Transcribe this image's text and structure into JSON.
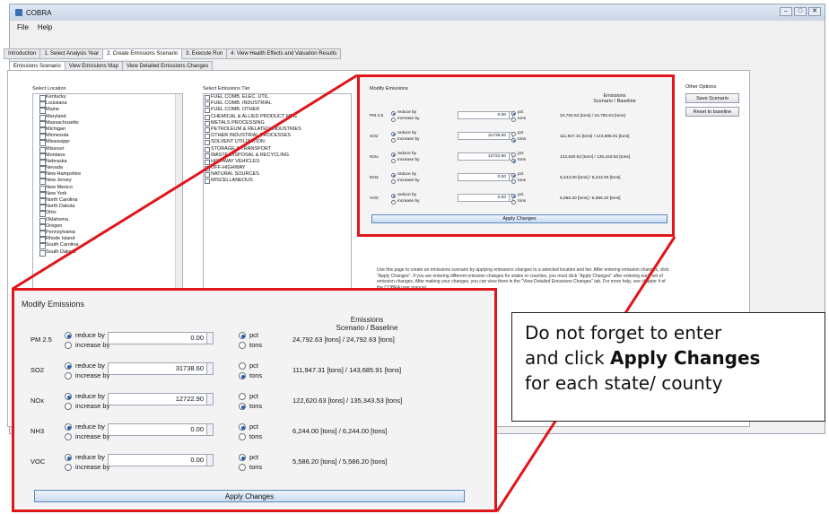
{
  "window": {
    "title": "COBRA"
  },
  "menu": [
    "File",
    "Help"
  ],
  "main_tabs": [
    {
      "label": "Introduction",
      "active": false
    },
    {
      "label": "1. Select Analysis Year",
      "active": false
    },
    {
      "label": "2. Create Emissions Scenario",
      "active": true
    },
    {
      "label": "3. Execute Run",
      "active": false
    },
    {
      "label": "4. View Health Effects and Valuation Results",
      "active": false
    }
  ],
  "sub_tabs": [
    {
      "label": "Emissions Scenario",
      "active": true
    },
    {
      "label": "View Emissions Map",
      "active": false
    },
    {
      "label": "View Detailed Emissions Changes",
      "active": false
    }
  ],
  "select_location": {
    "label": "Select Location",
    "items": [
      "Kentucky",
      "Louisiana",
      "Maine",
      "Maryland",
      "Massachusetts",
      "Michigan",
      "Minnesota",
      "Mississippi",
      "Missouri",
      "Montana",
      "Nebraska",
      "Nevada",
      "New Hampshire",
      "New Jersey",
      "New Mexico",
      "New York",
      "North Carolina",
      "North Dakota",
      "Ohio",
      "Oklahoma",
      "Oregon",
      "Pennsylvania",
      "Rhode Island",
      "South Carolina",
      "South Dakota"
    ]
  },
  "select_tier": {
    "label": "Select Emissions Tier",
    "items": [
      "FUEL COMB. ELEC. UTIL.",
      "FUEL COMB. INDUSTRIAL",
      "FUEL COMB. OTHER",
      "CHEMICAL & ALLIED PRODUCT MFG",
      "METALS PROCESSING",
      "PETROLEUM & RELATED INDUSTRIES",
      "OTHER INDUSTRIAL PROCESSES",
      "SOLVENT UTILIZATION",
      "STORAGE & TRANSPORT",
      "WASTE DISPOSAL & RECYCLING",
      "HIGHWAY VEHICLES",
      "OFF-HIGHWAY",
      "NATURAL SOURCES",
      "MISCELLANEOUS"
    ]
  },
  "other_options": {
    "label": "Other Options",
    "save": "Save Scenario",
    "reset": "Reset to baseline"
  },
  "help_text": "Use this page to create an emissions scenario by applying emissions changes to a selected location and tier. After entering emission changes, click \"Apply Changes\". If you are entering different emission changes for states or counties, you must click \"Apply Changes\" after entering each set of emission changes. After making your changes, you can view them in the \"View Detailed Emissions Changes\" tab. For more help, see chapter 4 of the COBRA user manual.",
  "modify": {
    "title": "Modify Emissions",
    "header_line1": "Emissions",
    "header_line2": "Scenario / Baseline",
    "reduce_label": "reduce by",
    "increase_label": "increase by",
    "pct_label": "pct",
    "tons_label": "tons",
    "apply_label": "Apply Changes",
    "rows": [
      {
        "pollutant": "PM 2.5",
        "value": "0.00",
        "reduce": true,
        "unit_pct": true,
        "result": "24,792.63 [tons] / 24,792.63 [tons]"
      },
      {
        "pollutant": "SO2",
        "value": "31738.60",
        "reduce": true,
        "unit_pct": false,
        "result": "111,947.31 [tons] / 143,685.91 [tons]"
      },
      {
        "pollutant": "NOx",
        "value": "12722.90",
        "reduce": true,
        "unit_pct": false,
        "result": "122,620.63 [tons] / 135,343.53 [tons]"
      },
      {
        "pollutant": "NH3",
        "value": "0.00",
        "reduce": true,
        "unit_pct": true,
        "result": "6,244.00 [tons] / 6,244.00 [tons]"
      },
      {
        "pollutant": "VOC",
        "value": "0.00",
        "reduce": true,
        "unit_pct": true,
        "result": "5,586.20 [tons] / 5,586.20 [tons]"
      }
    ]
  },
  "callout": {
    "line1": "Do not forget to enter",
    "line2_prefix": "and click ",
    "line2_bold": "Apply Changes",
    "line3": "for each state/ county"
  },
  "colors": {
    "highlight": "#e0161b",
    "accent": "#1f5fb0"
  }
}
